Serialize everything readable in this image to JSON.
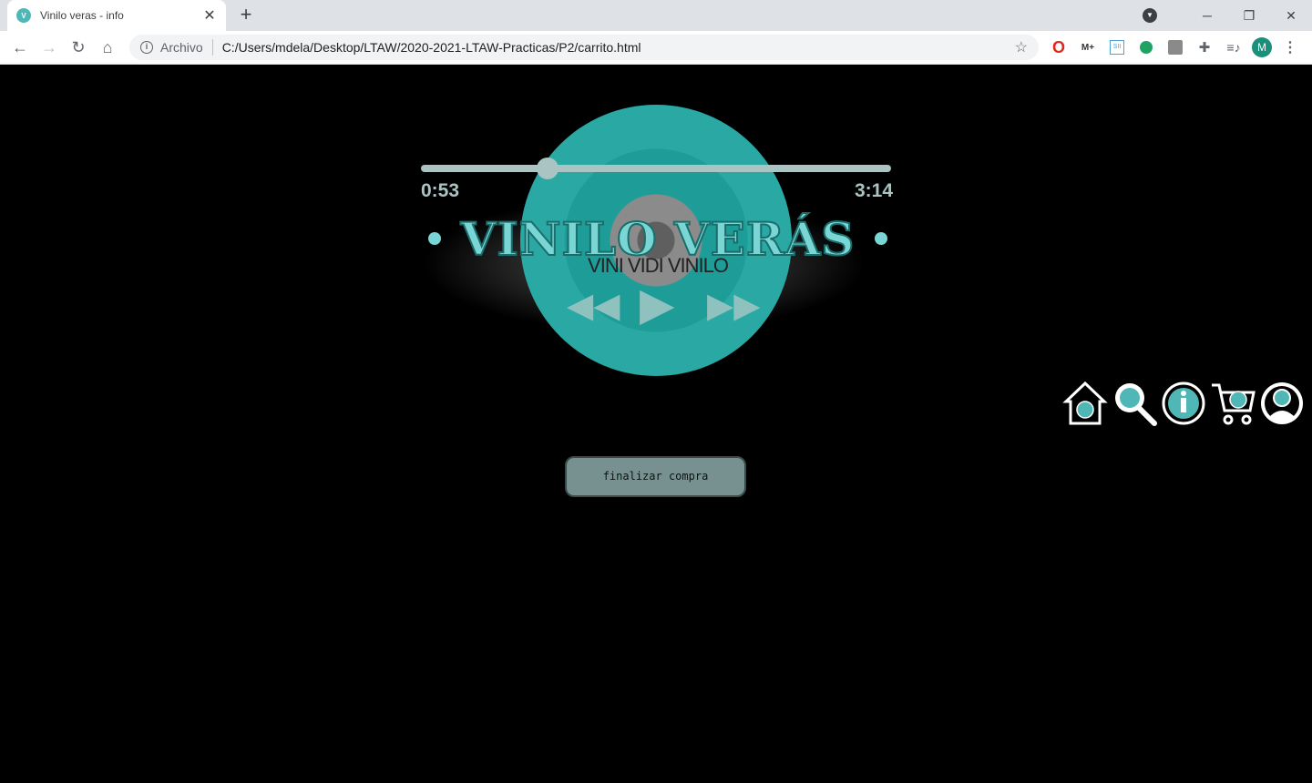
{
  "browser": {
    "tab_title": "Vinilo veras - info",
    "new_tab_label": "+",
    "url_scheme_label": "Archivo",
    "url": "C:/Users/mdela/Desktop/LTAW/2020-2021-LTAW-Practicas/P2/carrito.html",
    "profile_initial": "M",
    "icons": [
      "back-icon",
      "forward-icon",
      "reload-icon",
      "home-icon",
      "info-icon",
      "star-icon",
      "puzzle-icon",
      "media-icon",
      "menu-icon"
    ]
  },
  "player": {
    "progress_fraction": 0.27,
    "time_elapsed": "0:53",
    "time_total": "3:14",
    "brand_title": "VINILO VERÁS",
    "brand_subtitle": "VINI VIDI VINILO",
    "accent_color": "#7ad6d4",
    "disc_color": "#2aa8a3"
  },
  "nav": {
    "items": [
      "home-icon",
      "search-icon",
      "info-icon",
      "cart-icon",
      "user-icon"
    ]
  },
  "checkout": {
    "button_label": "finalizar compra"
  }
}
